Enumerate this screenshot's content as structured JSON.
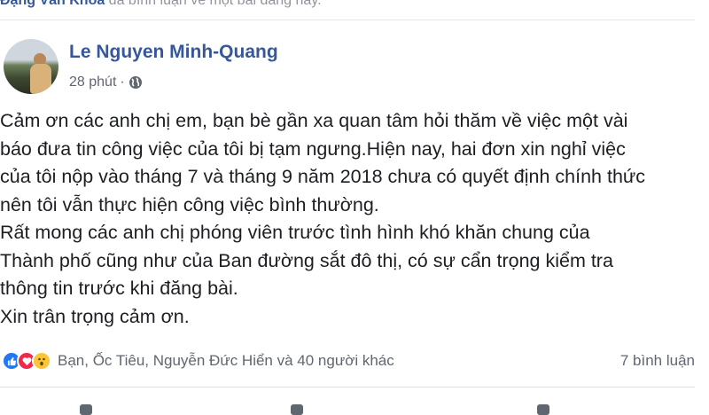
{
  "notice": {
    "actor": "Đặng Văn Khoa",
    "text": " đã bình luận về một bài đăng này."
  },
  "post": {
    "author": "Le Nguyen Minh-Quang",
    "time": "28 phút",
    "separator": "·",
    "privacy_icon": "globe-icon",
    "lines": [
      "Cảm ơn các anh chị em, bạn bè gần xa quan tâm hỏi thăm về việc một vài",
      "báo đưa tin công việc của tôi bị tạm ngưng.Hiện nay, hai đơn xin nghỉ việc",
      "của tôi nộp vào tháng 7 và tháng 9 năm 2018 chưa có quyết định chính thức",
      "nên tôi vẫn thực hiện công việc bình thường.",
      "Rất mong các anh chị phóng viên trước tình hình khó khăn chung của",
      "Thành phố cũng như của Ban đường sắt đô thị, có sự cẩn trọng kiểm tra",
      "thông tin trước khi đăng bài.",
      "Xin trân trọng cảm ơn."
    ]
  },
  "reactions": {
    "icons": [
      "like-icon",
      "love-icon",
      "wow-icon"
    ],
    "names": "Bạn, Ốc Tiêu, Nguyễn Đức Hiển và 40 người khác",
    "comments": "7 bình luận"
  },
  "colors": {
    "link": "#365899",
    "text": "#1c1e21",
    "muted": "#616770",
    "like": "#2078f4",
    "love": "#f0284a",
    "wow": "#fcc537"
  }
}
